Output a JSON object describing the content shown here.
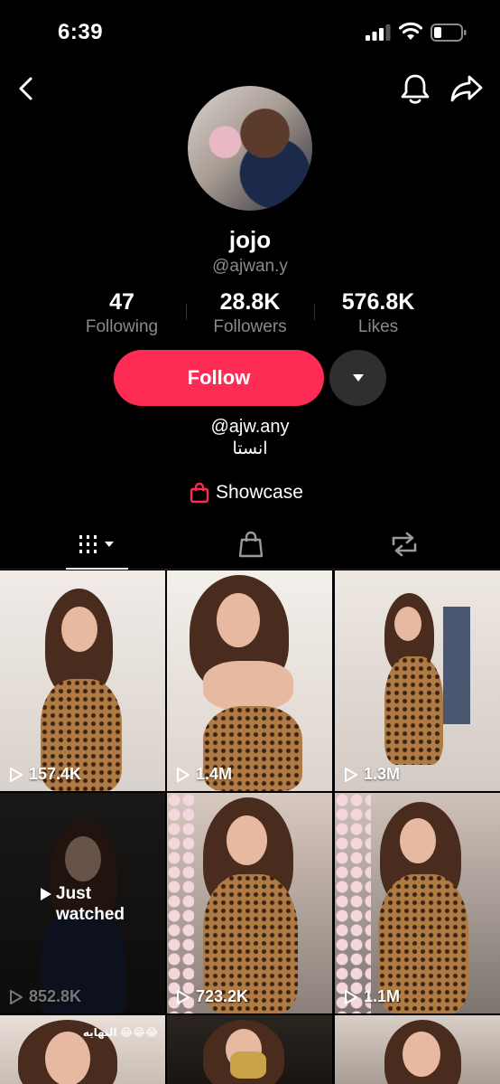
{
  "status": {
    "time": "6:39"
  },
  "profile": {
    "name": "jojo",
    "handle": "@ajwan.y",
    "stats": [
      {
        "num": "47",
        "label": "Following"
      },
      {
        "num": "28.8K",
        "label": "Followers"
      },
      {
        "num": "576.8K",
        "label": "Likes"
      }
    ],
    "follow_label": "Follow",
    "bio_line1": "@ajw.any",
    "bio_line2": "انستا",
    "showcase_label": "Showcase"
  },
  "colors": {
    "accent": "#fe2c55",
    "background": "#000000",
    "muted": "#8a8a8a"
  },
  "icons": {
    "back": "back-chevron-icon",
    "bell": "bell-icon",
    "share": "share-arrow-icon",
    "dropdown": "caret-down-icon",
    "bag": "shopping-bag-icon",
    "grid": "grid-icon",
    "repost": "repost-icon",
    "play": "play-icon"
  },
  "grid": {
    "videos": [
      {
        "views": "157.4K"
      },
      {
        "views": "1.4M"
      },
      {
        "views": "1.3M"
      },
      {
        "views": "852.8K",
        "badge_line1": "Just",
        "badge_line2": "watched"
      },
      {
        "views": "723.2K"
      },
      {
        "views": "1.1M"
      },
      {
        "caption_tag": "النهايه 😂😂😂"
      },
      {},
      {}
    ]
  }
}
